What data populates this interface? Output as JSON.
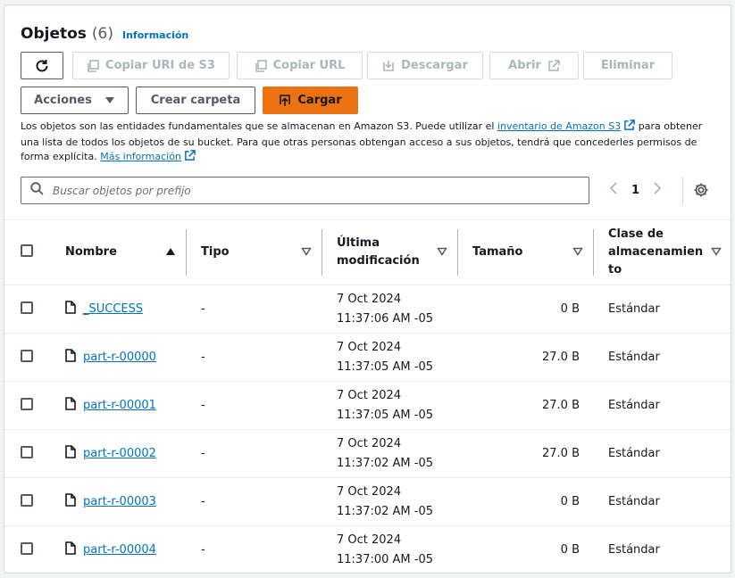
{
  "header": {
    "title": "Objetos",
    "count": "(6)",
    "info": "Información"
  },
  "toolbar": {
    "refresh_icon": "refresh-icon",
    "copy_uri": "Copiar URI de S3",
    "copy_url": "Copiar URL",
    "download": "Descargar",
    "open": "Abrir",
    "delete": "Eliminar",
    "actions": "Acciones",
    "create_folder": "Crear carpeta",
    "upload": "Cargar"
  },
  "description": {
    "part1": "Los objetos son las entidades fundamentales que se almacenan en Amazon S3. Puede utilizar el ",
    "inventory_link": "inventario de Amazon S3",
    "part2": " para obtener una lista de todos los objetos de su bucket. Para que otras personas obtengan acceso a sus objetos, tendrá que concederles permisos de forma explícita. ",
    "more_link": "Más información"
  },
  "search": {
    "placeholder": "Buscar objetos por prefijo",
    "value": ""
  },
  "pagination": {
    "current_page": "1"
  },
  "table": {
    "columns": {
      "name": "Nombre",
      "type": "Tipo",
      "modified_1": "Última",
      "modified_2": "modificación",
      "size": "Tamaño",
      "class_1": "Clase de",
      "class_2": "almacenamien",
      "class_3": "to"
    },
    "rows": [
      {
        "name": "_SUCCESS",
        "type": "-",
        "date": "7 Oct 2024",
        "time": "11:37:06 AM -05",
        "size": "0 B",
        "class": "Estándar"
      },
      {
        "name": "part-r-00000",
        "type": "-",
        "date": "7 Oct 2024",
        "time": "11:37:05 AM -05",
        "size": "27.0 B",
        "class": "Estándar"
      },
      {
        "name": "part-r-00001",
        "type": "-",
        "date": "7 Oct 2024",
        "time": "11:37:05 AM -05",
        "size": "27.0 B",
        "class": "Estándar"
      },
      {
        "name": "part-r-00002",
        "type": "-",
        "date": "7 Oct 2024",
        "time": "11:37:02 AM -05",
        "size": "27.0 B",
        "class": "Estándar"
      },
      {
        "name": "part-r-00003",
        "type": "-",
        "date": "7 Oct 2024",
        "time": "11:37:02 AM -05",
        "size": "0 B",
        "class": "Estándar"
      },
      {
        "name": "part-r-00004",
        "type": "-",
        "date": "7 Oct 2024",
        "time": "11:37:00 AM -05",
        "size": "0 B",
        "class": "Estándar"
      }
    ]
  },
  "colors": {
    "accent": "#ec7211",
    "link": "#0073bb",
    "text": "#16191f",
    "disabled": "#aab7b8"
  }
}
